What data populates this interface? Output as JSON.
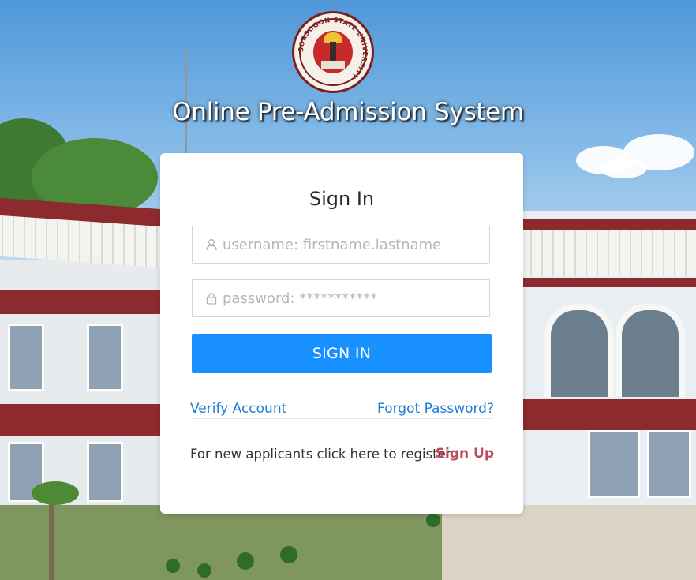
{
  "app": {
    "title": "Online Pre-Admission System",
    "logo_text": "SORSOGON STATE UNIVERSITY"
  },
  "signin": {
    "heading": "Sign In",
    "username_placeholder": "username: firstname.lastname",
    "password_placeholder": "password: ***********",
    "button_label": "SIGN IN",
    "verify_link": "Verify Account",
    "forgot_link": "Forgot Password?",
    "register_prompt": "For new applicants click here to register",
    "signup_link": "Sign Up"
  },
  "icons": {
    "username": "user-icon",
    "password": "lock-icon"
  },
  "colors": {
    "primary": "#1890ff",
    "link": "#1d7bd6",
    "signup": "#c04a5c",
    "brand_maroon": "#7d1f1f"
  }
}
